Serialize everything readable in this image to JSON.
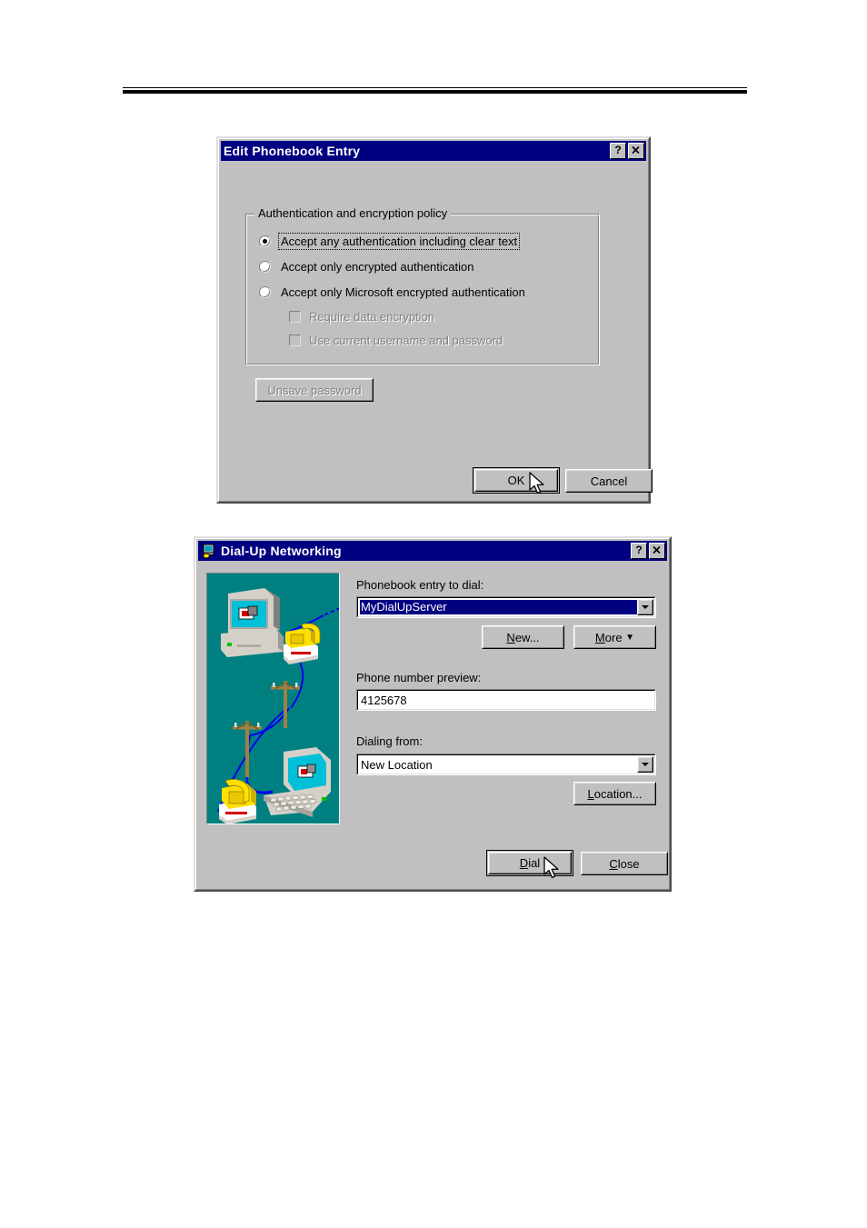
{
  "page": {
    "header_rule": "horizontal-rule"
  },
  "dialog1": {
    "title": "Edit Phonebook Entry",
    "help_button": "?",
    "close_button": "✕",
    "group": {
      "label": "Authentication and encryption policy",
      "radios": [
        {
          "label": "Accept any authentication including clear text",
          "selected": true,
          "focused": true
        },
        {
          "label": "Accept only encrypted authentication",
          "selected": false,
          "focused": false
        },
        {
          "label": "Accept only Microsoft encrypted authentication",
          "selected": false,
          "focused": false
        }
      ],
      "checkboxes": [
        {
          "label": "Require data encryption",
          "checked": false,
          "enabled": false
        },
        {
          "label": "Use current username and password",
          "checked": false,
          "enabled": false
        }
      ]
    },
    "unsave_password_button": "Unsave password",
    "ok_button": "OK",
    "cancel_button": "Cancel"
  },
  "dialog2": {
    "title": "Dial-Up Networking",
    "sys_icon": "dialup-networking-icon",
    "help_button": "?",
    "close_button": "✕",
    "phonebook_label": "Phonebook entry to dial:",
    "phonebook_value": "MyDialUpServer",
    "new_button": "New...",
    "more_button": "More",
    "phone_preview_label": "Phone number preview:",
    "phone_preview_value": "4125678",
    "dialing_from_label": "Dialing from:",
    "dialing_from_value": "New Location",
    "location_button": "Location...",
    "dial_button": "Dial",
    "close_label": "Close",
    "illustration": "dialup-networking-illustration"
  },
  "colors": {
    "titlebar": "#000080",
    "dialog_face": "#c0c0c0",
    "illustration_bg": "#008080",
    "selection": "#000080",
    "disabled_text": "#808080"
  }
}
